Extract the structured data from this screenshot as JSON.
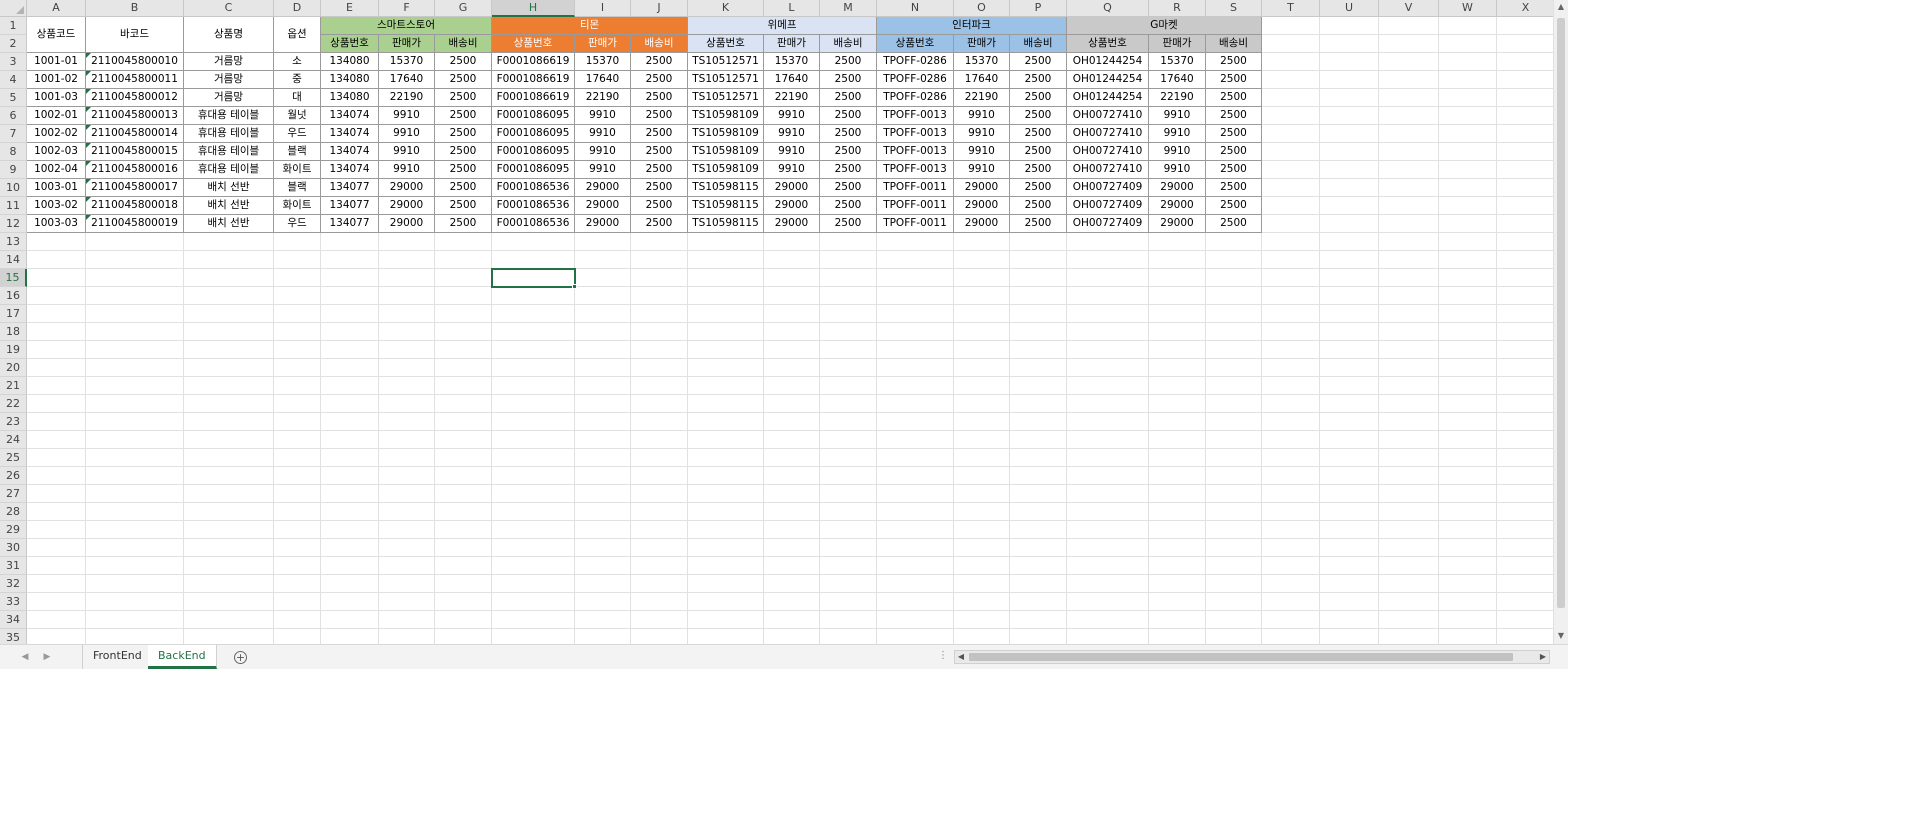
{
  "columns": [
    "A",
    "B",
    "C",
    "D",
    "E",
    "F",
    "G",
    "H",
    "I",
    "J",
    "K",
    "L",
    "M",
    "N",
    "O",
    "P",
    "Q",
    "R",
    "S",
    "T",
    "U",
    "V",
    "W",
    "X"
  ],
  "selected_column": "H",
  "rows": [
    "1",
    "2",
    "3",
    "4",
    "5",
    "6",
    "7",
    "8",
    "9",
    "10",
    "11",
    "12",
    "13",
    "14",
    "15",
    "16",
    "17",
    "18",
    "19",
    "20",
    "21",
    "22",
    "23",
    "24",
    "25",
    "26",
    "27",
    "28",
    "29",
    "30",
    "31",
    "32",
    "33",
    "34",
    "35"
  ],
  "selected_row": "15",
  "header": {
    "merged": [
      "상품코드",
      "바코드",
      "상품명",
      "옵션"
    ],
    "groups": [
      {
        "name": "스마트스토어",
        "color": "#a9d08e",
        "sub_color": "#a9d08e"
      },
      {
        "name": "티몬",
        "color": "#ed7d31",
        "sub_color": "#ed7d31"
      },
      {
        "name": "위메프",
        "color": "#dae3f3",
        "sub_color": "#dae3f3"
      },
      {
        "name": "인터파크",
        "color": "#9bc2e6",
        "sub_color": "#9bc2e6"
      },
      {
        "name": "G마켓",
        "color": "#c9c9c9",
        "sub_color": "#c9c9c9"
      }
    ],
    "sub_labels": [
      "상품번호",
      "판매가",
      "배송비"
    ]
  },
  "data_rows": [
    [
      "1001-01",
      "2110045800010",
      "거름망",
      "소",
      "134080",
      "15370",
      "2500",
      "F0001086619",
      "15370",
      "2500",
      "TS10512571",
      "15370",
      "2500",
      "TPOFF-0286",
      "15370",
      "2500",
      "OH01244254",
      "15370",
      "2500"
    ],
    [
      "1001-02",
      "2110045800011",
      "거름망",
      "중",
      "134080",
      "17640",
      "2500",
      "F0001086619",
      "17640",
      "2500",
      "TS10512571",
      "17640",
      "2500",
      "TPOFF-0286",
      "17640",
      "2500",
      "OH01244254",
      "17640",
      "2500"
    ],
    [
      "1001-03",
      "2110045800012",
      "거름망",
      "대",
      "134080",
      "22190",
      "2500",
      "F0001086619",
      "22190",
      "2500",
      "TS10512571",
      "22190",
      "2500",
      "TPOFF-0286",
      "22190",
      "2500",
      "OH01244254",
      "22190",
      "2500"
    ],
    [
      "1002-01",
      "2110045800013",
      "휴대용 테이블",
      "월넛",
      "134074",
      "9910",
      "2500",
      "F0001086095",
      "9910",
      "2500",
      "TS10598109",
      "9910",
      "2500",
      "TPOFF-0013",
      "9910",
      "2500",
      "OH00727410",
      "9910",
      "2500"
    ],
    [
      "1002-02",
      "2110045800014",
      "휴대용 테이블",
      "우드",
      "134074",
      "9910",
      "2500",
      "F0001086095",
      "9910",
      "2500",
      "TS10598109",
      "9910",
      "2500",
      "TPOFF-0013",
      "9910",
      "2500",
      "OH00727410",
      "9910",
      "2500"
    ],
    [
      "1002-03",
      "2110045800015",
      "휴대용 테이블",
      "블랙",
      "134074",
      "9910",
      "2500",
      "F0001086095",
      "9910",
      "2500",
      "TS10598109",
      "9910",
      "2500",
      "TPOFF-0013",
      "9910",
      "2500",
      "OH00727410",
      "9910",
      "2500"
    ],
    [
      "1002-04",
      "2110045800016",
      "휴대용 테이블",
      "화이트",
      "134074",
      "9910",
      "2500",
      "F0001086095",
      "9910",
      "2500",
      "TS10598109",
      "9910",
      "2500",
      "TPOFF-0013",
      "9910",
      "2500",
      "OH00727410",
      "9910",
      "2500"
    ],
    [
      "1003-01",
      "2110045800017",
      "배치 선반",
      "블랙",
      "134077",
      "29000",
      "2500",
      "F0001086536",
      "29000",
      "2500",
      "TS10598115",
      "29000",
      "2500",
      "TPOFF-0011",
      "29000",
      "2500",
      "OH00727409",
      "29000",
      "2500"
    ],
    [
      "1003-02",
      "2110045800018",
      "배치 선반",
      "화이트",
      "134077",
      "29000",
      "2500",
      "F0001086536",
      "29000",
      "2500",
      "TS10598115",
      "29000",
      "2500",
      "TPOFF-0011",
      "29000",
      "2500",
      "OH00727409",
      "29000",
      "2500"
    ],
    [
      "1003-03",
      "2110045800019",
      "배치 선반",
      "우드",
      "134077",
      "29000",
      "2500",
      "F0001086536",
      "29000",
      "2500",
      "TS10598115",
      "29000",
      "2500",
      "TPOFF-0011",
      "29000",
      "2500",
      "OH00727409",
      "29000",
      "2500"
    ]
  ],
  "sheet_tabs": [
    {
      "label": "FrontEnd",
      "active": false
    },
    {
      "label": "BackEnd",
      "active": true
    }
  ],
  "icons": {
    "prev_sheet": "◀",
    "next_sheet": "▶",
    "add_sheet": "+",
    "more": "⋮",
    "scroll_left": "◀",
    "scroll_right": "▶",
    "scroll_up": "▲",
    "scroll_down": "▼"
  },
  "colors": {
    "accent": "#217346"
  }
}
